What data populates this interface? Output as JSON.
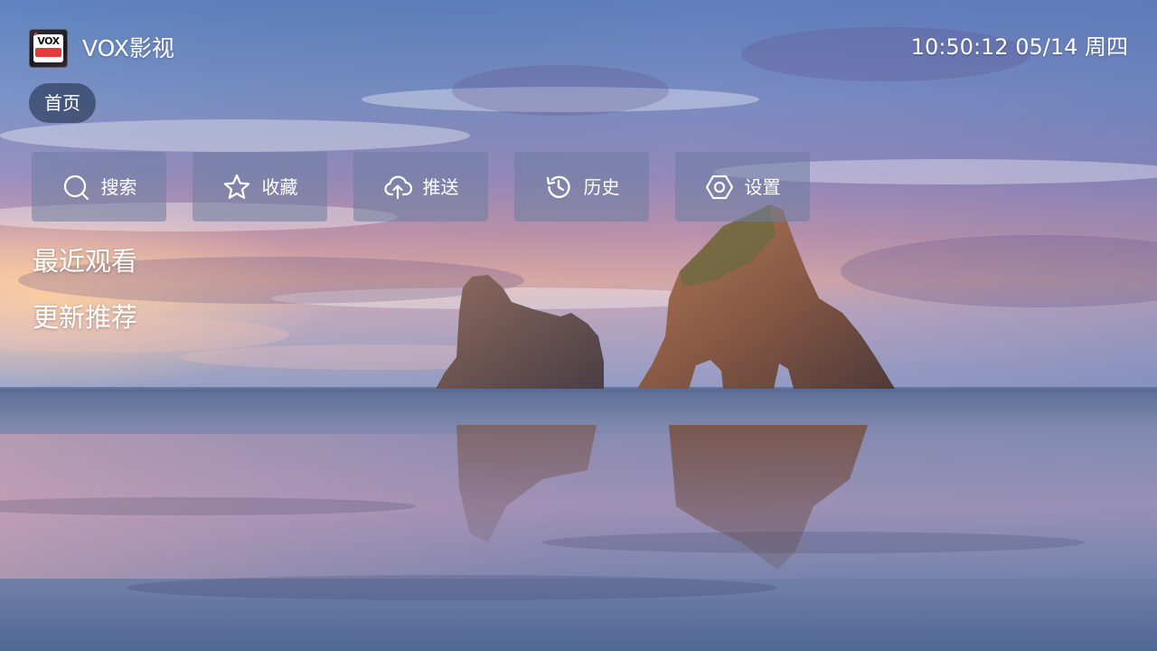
{
  "app": {
    "title": "VOX影视",
    "logo_text": "VOX"
  },
  "status": {
    "clock": "10:50:12 05/14 周四"
  },
  "nav": {
    "home_tab": "首页"
  },
  "actions": [
    {
      "label": "搜索",
      "icon": "search-icon"
    },
    {
      "label": "收藏",
      "icon": "star-icon"
    },
    {
      "label": "推送",
      "icon": "cloud-upload-icon"
    },
    {
      "label": "历史",
      "icon": "history-icon"
    },
    {
      "label": "设置",
      "icon": "settings-icon"
    }
  ],
  "sections": {
    "recent": "最近观看",
    "recommended": "更新推荐"
  },
  "colors": {
    "button_bg": "#6e7da0",
    "tab_bg": "#283755",
    "text": "#ffffff"
  }
}
